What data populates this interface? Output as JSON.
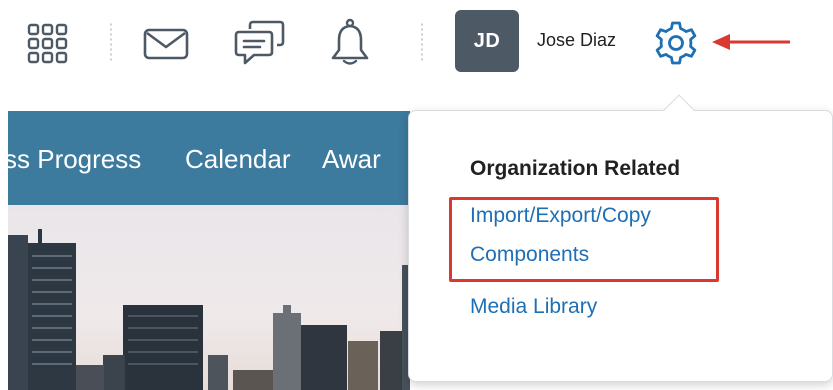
{
  "topbar": {
    "icons": [
      "app-launcher-icon",
      "mail-icon",
      "chat-icon",
      "bell-icon",
      "gear-icon"
    ],
    "avatar_initials": "JD",
    "avatar_color": "#4d5a66",
    "user_name": "Jose Diaz",
    "annotation": "red-arrow-icon"
  },
  "navbar": {
    "background": "#3c7a9e",
    "items": [
      "ss Progress",
      "Calendar",
      "Awar"
    ]
  },
  "dropdown": {
    "heading": "Organization Related",
    "links": {
      "import_export_line1": "Import/Export/Copy",
      "import_export_line2": "Components",
      "media_library": "Media Library"
    },
    "link_color": "#1f6fb5",
    "highlight_color": "#d83a2f"
  }
}
